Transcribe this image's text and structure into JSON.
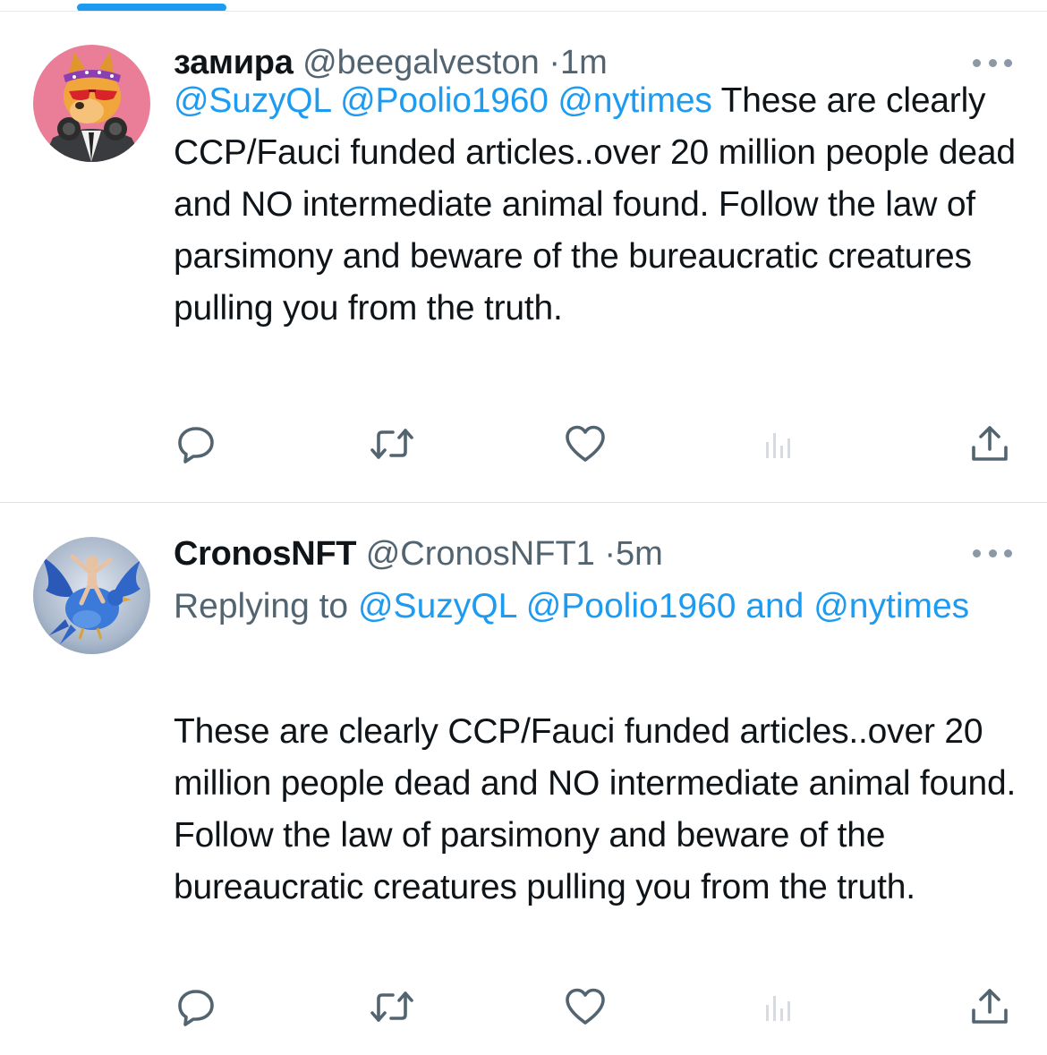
{
  "colors": {
    "accent": "#1d9bf0",
    "text_primary": "#0f1419",
    "text_secondary": "#536471",
    "divider": "#e7e9ea"
  },
  "tweets": [
    {
      "display_name": "замира",
      "handle": "@beegalveston",
      "separator": "·",
      "time": "1m",
      "mentions": [
        "@SuzyQL",
        "@Poolio1960",
        "@nytimes"
      ],
      "text": "These are clearly CCP/Fauci funded articles..over 20 million people dead and NO intermediate animal found. Follow the law of parsimony and beware of the bureaucratic creatures pulling you from the truth.",
      "avatar_icon": "cartoon-dog-avatar-icon"
    },
    {
      "display_name": "CronosNFT",
      "handle": "@CronosNFT1",
      "separator": "·",
      "time": "5m",
      "replying_to_label": "Replying to",
      "replying_to": [
        "@SuzyQL",
        "@Poolio1960",
        "@nytimes"
      ],
      "replying_and": "and",
      "text": "These are clearly CCP/Fauci funded articles..over 20 million people dead and NO intermediate animal found. Follow the law of parsimony and beware of the bureaucratic creatures pulling you from the truth.",
      "avatar_icon": "figure-riding-bird-avatar-icon"
    }
  ],
  "action_icons": [
    "reply-icon",
    "retweet-icon",
    "like-icon",
    "views-icon",
    "share-icon"
  ]
}
